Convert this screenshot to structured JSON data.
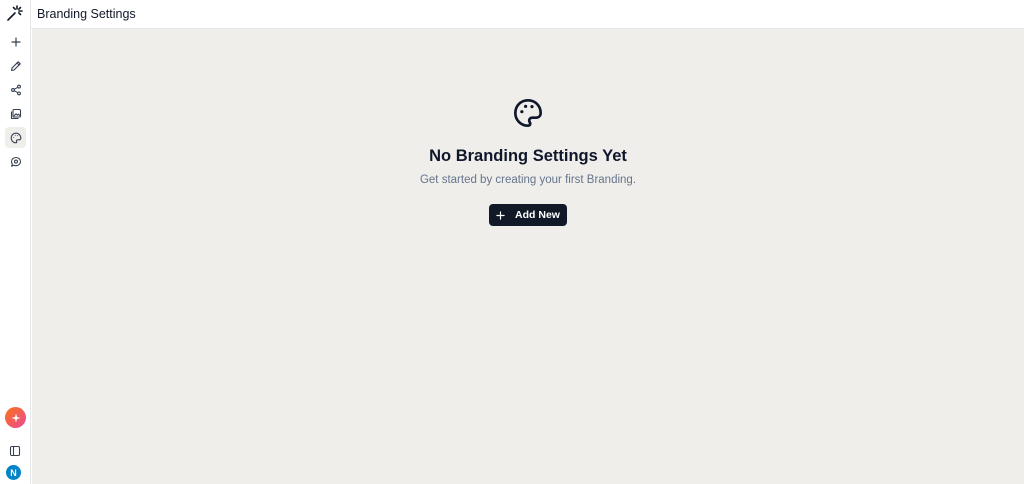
{
  "header": {
    "title": "Branding Settings"
  },
  "sidebar": {
    "logo_icon": "magic-wand-icon",
    "items": [
      {
        "icon": "plus-icon",
        "name": "new"
      },
      {
        "icon": "pen-icon",
        "name": "edit"
      },
      {
        "icon": "share-icon",
        "name": "share"
      },
      {
        "icon": "gallery-icon",
        "name": "gallery"
      },
      {
        "icon": "palette-icon",
        "name": "branding",
        "active": true
      },
      {
        "icon": "chat-icon",
        "name": "chat"
      }
    ],
    "assistant_icon": "sparkle-icon",
    "panel_toggle_icon": "sidebar-panel-icon",
    "avatar_initial": "N"
  },
  "empty_state": {
    "icon": "palette-icon",
    "title": "No Branding Settings Yet",
    "subtitle": "Get started by creating your first Branding.",
    "button_icon": "plus-icon",
    "button_label": "Add New"
  },
  "colors": {
    "background": "#f0eeeb",
    "button": "#111827",
    "avatar": "#0284c7",
    "subtitle": "#64748b"
  }
}
